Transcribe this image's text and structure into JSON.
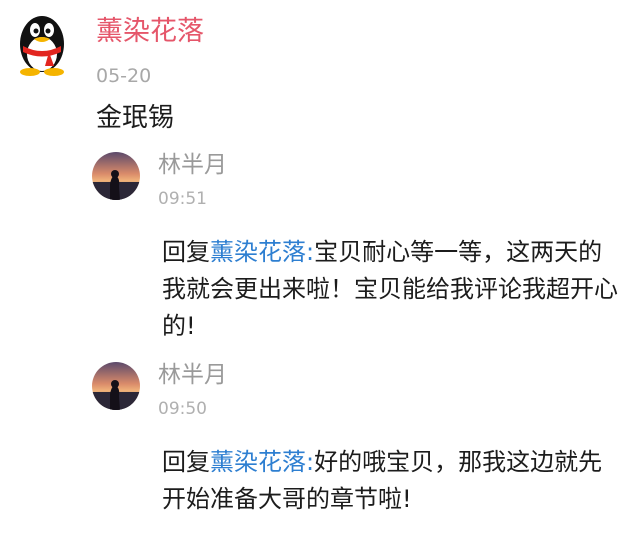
{
  "post": {
    "author": "薰染花落",
    "date": "05-20",
    "content": "金珉锡",
    "avatar_icon": "qq-penguin-icon"
  },
  "replies": [
    {
      "author": "林半月",
      "time": "09:51",
      "prefix": "回复",
      "mention": "薰染花落:",
      "text": "宝贝耐心等一等，这两天的我就会更出来啦！宝贝能给我评论我超开心的!",
      "avatar_icon": "sunset-avatar-icon"
    },
    {
      "author": "林半月",
      "time": "09:50",
      "prefix": "回复",
      "mention": "薰染花落:",
      "text": "好的哦宝贝，那我这边就先开始准备大哥的章节啦!",
      "avatar_icon": "sunset-avatar-icon"
    }
  ],
  "colors": {
    "author_name": "#e5566a",
    "mention": "#2e7fd1",
    "muted": "#a8a8a8"
  }
}
